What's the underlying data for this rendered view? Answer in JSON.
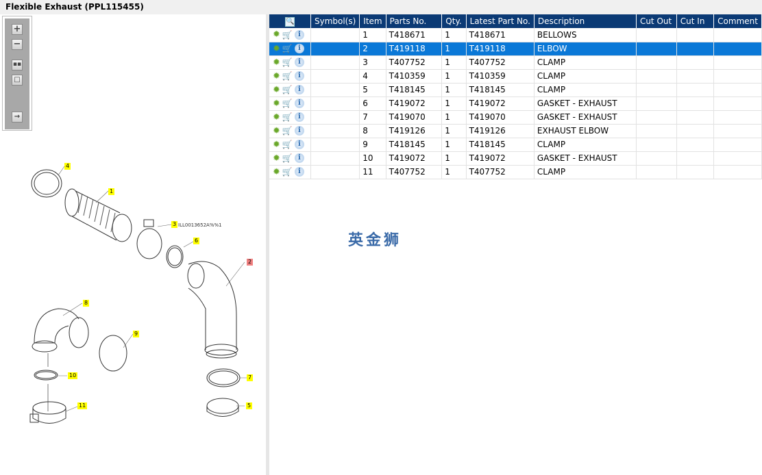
{
  "title": "Flexible Exhaust (PPL115455)",
  "toolbar": [
    "zoom-in",
    "zoom-out",
    "fit-all",
    "actual-size",
    "export"
  ],
  "columns": [
    "Symbol(s)",
    "Item",
    "Parts No.",
    "Qty.",
    "Latest Part No.",
    "Description",
    "Cut Out",
    "Cut In",
    "Comment"
  ],
  "rows": [
    {
      "item": "1",
      "part": "T418671",
      "qty": "1",
      "latest": "T418671",
      "desc": "BELLOWS"
    },
    {
      "item": "2",
      "part": "T419118",
      "qty": "1",
      "latest": "T419118",
      "desc": "ELBOW"
    },
    {
      "item": "3",
      "part": "T407752",
      "qty": "1",
      "latest": "T407752",
      "desc": "CLAMP"
    },
    {
      "item": "4",
      "part": "T410359",
      "qty": "1",
      "latest": "T410359",
      "desc": "CLAMP"
    },
    {
      "item": "5",
      "part": "T418145",
      "qty": "1",
      "latest": "T418145",
      "desc": "CLAMP"
    },
    {
      "item": "6",
      "part": "T419072",
      "qty": "1",
      "latest": "T419072",
      "desc": "GASKET - EXHAUST"
    },
    {
      "item": "7",
      "part": "T419070",
      "qty": "1",
      "latest": "T419070",
      "desc": "GASKET - EXHAUST"
    },
    {
      "item": "8",
      "part": "T419126",
      "qty": "1",
      "latest": "T419126",
      "desc": "EXHAUST ELBOW"
    },
    {
      "item": "9",
      "part": "T418145",
      "qty": "1",
      "latest": "T418145",
      "desc": "CLAMP"
    },
    {
      "item": "10",
      "part": "T419072",
      "qty": "1",
      "latest": "T419072",
      "desc": "GASKET - EXHAUST"
    },
    {
      "item": "11",
      "part": "T407752",
      "qty": "1",
      "latest": "T407752",
      "desc": "CLAMP"
    }
  ],
  "selected_item": "2",
  "diagram": {
    "ref": "ILL0013652A%%1",
    "callouts": [
      "1",
      "2",
      "3",
      "4",
      "5",
      "6",
      "7",
      "8",
      "9",
      "10",
      "11"
    ]
  },
  "watermark": "英金狮"
}
